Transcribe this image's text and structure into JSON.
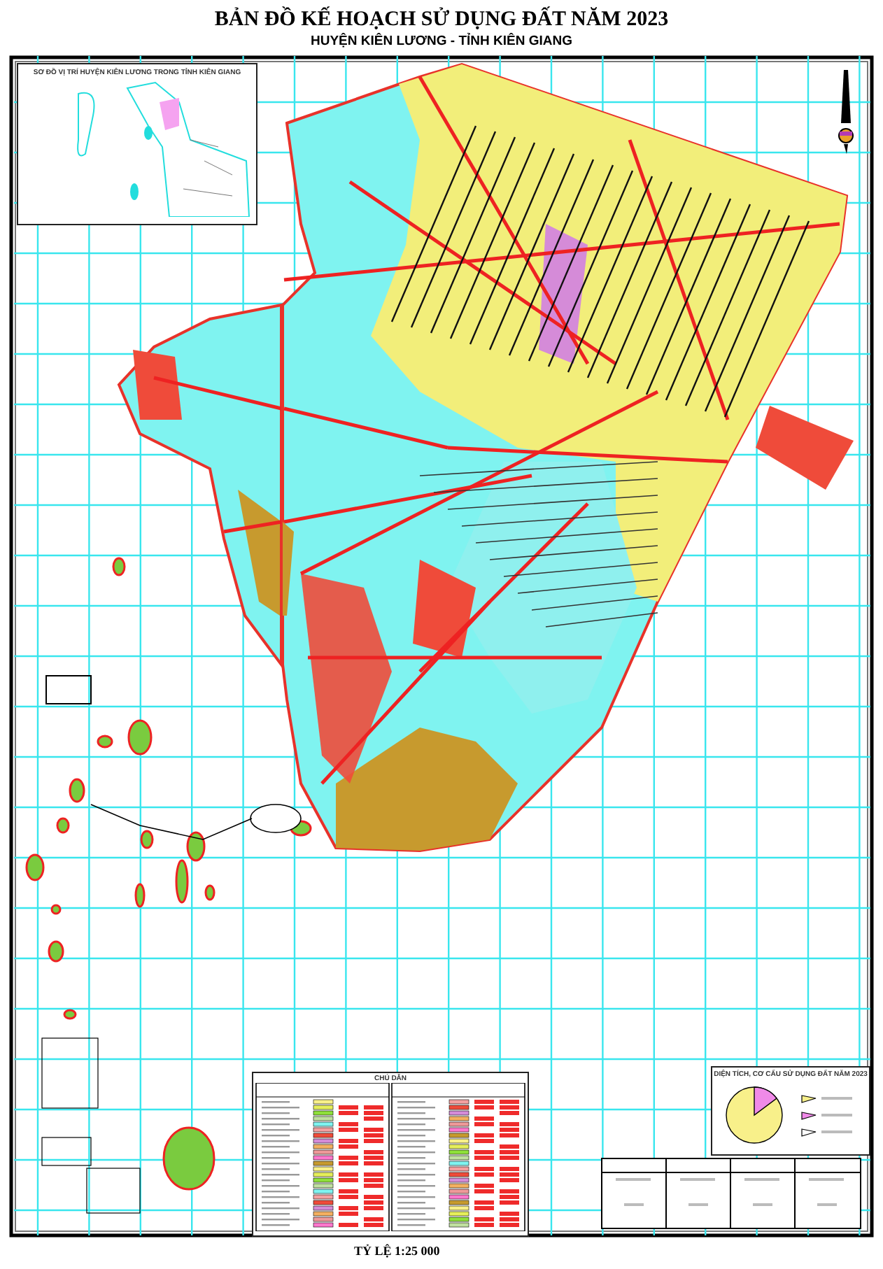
{
  "title": "BẢN ĐỒ KẾ HOẠCH SỬ DỤNG ĐẤT NĂM 2023",
  "subtitle": "HUYỆN KIÊN LƯƠNG - TỈNH KIÊN GIANG",
  "inset": {
    "title": "SƠ ĐỒ VỊ TRÍ HUYỆN KIÊN LƯƠNG TRONG TỈNH KIÊN GIANG"
  },
  "legend": {
    "title": "CHÚ DẪN"
  },
  "pie_panel": {
    "title": "DIỆN TÍCH, CƠ CẤU SỬ DỤNG ĐẤT NĂM 2023"
  },
  "scale": "TỶ LỆ 1:25 000"
}
